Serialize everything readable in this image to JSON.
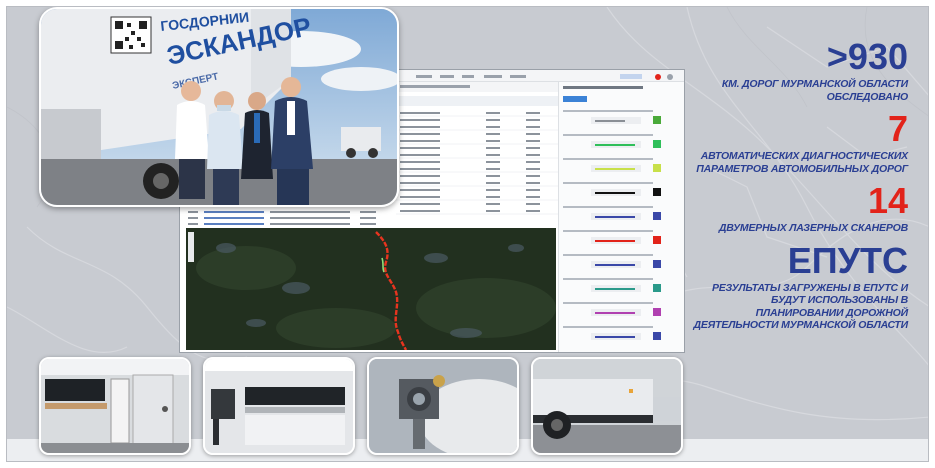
{
  "hero": {
    "truck_lettering": [
      "ГОСДОРНИИ",
      "ЭСКАНДОР",
      "ЭКСПЕРТ"
    ]
  },
  "stats": [
    {
      "value": ">930",
      "caption": "КМ. ДОРОГ МУРМАНСКОЙ ОБЛАСТИ ОБСЛЕДОВАНО",
      "color": "#2a3f93"
    },
    {
      "value": "7",
      "caption": "АВТОМАТИЧЕСКИХ ДИАГНОСТИЧЕСКИХ ПАРАМЕТРОВ АВТОМОБИЛЬНЫХ ДОРОГ",
      "color": "#e2231a"
    },
    {
      "value": "14",
      "caption": "ДВУМЕРНЫХ ЛАЗЕРНЫХ СКАНЕРОВ",
      "color": "#e2231a"
    },
    {
      "value": "ЕПУТС",
      "caption": "РЕЗУЛЬТАТЫ ЗАГРУЖЕНЫ В ЕПУТС И БУДУТ ИСПОЛЬЗОВАНЫ В ПЛАНИРОВАНИИ ДОРОЖНОЙ ДЕЯТЕЛЬНОСТИ МУРМАНСКОЙ ОБЛАСТИ",
      "color": "#2a3f93"
    }
  ],
  "colors": {
    "brand_blue": "#2a3f93",
    "accent_red": "#e2231a"
  }
}
